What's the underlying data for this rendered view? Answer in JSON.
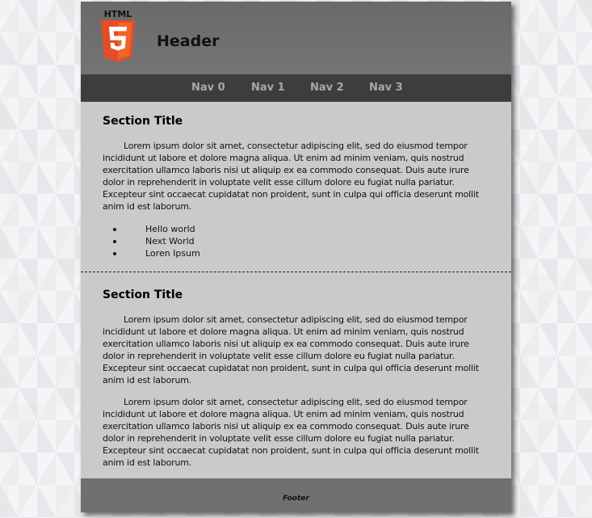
{
  "header": {
    "logo_text": "HTML",
    "title": "Header",
    "colors": {
      "logo_orange": "#e44d26",
      "logo_light": "#f16529"
    }
  },
  "nav": {
    "items": [
      {
        "label": "Nav 0"
      },
      {
        "label": "Nav 1"
      },
      {
        "label": "Nav 2"
      },
      {
        "label": "Nav 3"
      }
    ]
  },
  "sections": [
    {
      "title": "Section Title",
      "paragraphs": [
        "Lorem ipsum dolor sit amet, consectetur adipiscing elit, sed do eiusmod tempor incididunt ut labore et dolore magna aliqua. Ut enim ad minim veniam, quis nostrud exercitation ullamco laboris nisi ut aliquip ex ea commodo consequat. Duis aute irure dolor in reprehenderit in voluptate velit esse cillum dolore eu fugiat nulla pariatur. Excepteur sint occaecat cupidatat non proident, sunt in culpa qui officia deserunt mollit anim id est laborum."
      ],
      "list": [
        "Hello world",
        "Next World",
        "Loren Ipsum"
      ]
    },
    {
      "title": "Section Title",
      "paragraphs": [
        "Lorem ipsum dolor sit amet, consectetur adipiscing elit, sed do eiusmod tempor incididunt ut labore et dolore magna aliqua. Ut enim ad minim veniam, quis nostrud exercitation ullamco laboris nisi ut aliquip ex ea commodo consequat. Duis aute irure dolor in reprehenderit in voluptate velit esse cillum dolore eu fugiat nulla pariatur. Excepteur sint occaecat cupidatat non proident, sunt in culpa qui officia deserunt mollit anim id est laborum.",
        "Lorem ipsum dolor sit amet, consectetur adipiscing elit, sed do eiusmod tempor incididunt ut labore et dolore magna aliqua. Ut enim ad minim veniam, quis nostrud exercitation ullamco laboris nisi ut aliquip ex ea commodo consequat. Duis aute irure dolor in reprehenderit in voluptate velit esse cillum dolore eu fugiat nulla pariatur. Excepteur sint occaecat cupidatat non proident, sunt in culpa qui officia deserunt mollit anim id est laborum."
      ]
    }
  ],
  "footer": {
    "text": "Footer"
  }
}
